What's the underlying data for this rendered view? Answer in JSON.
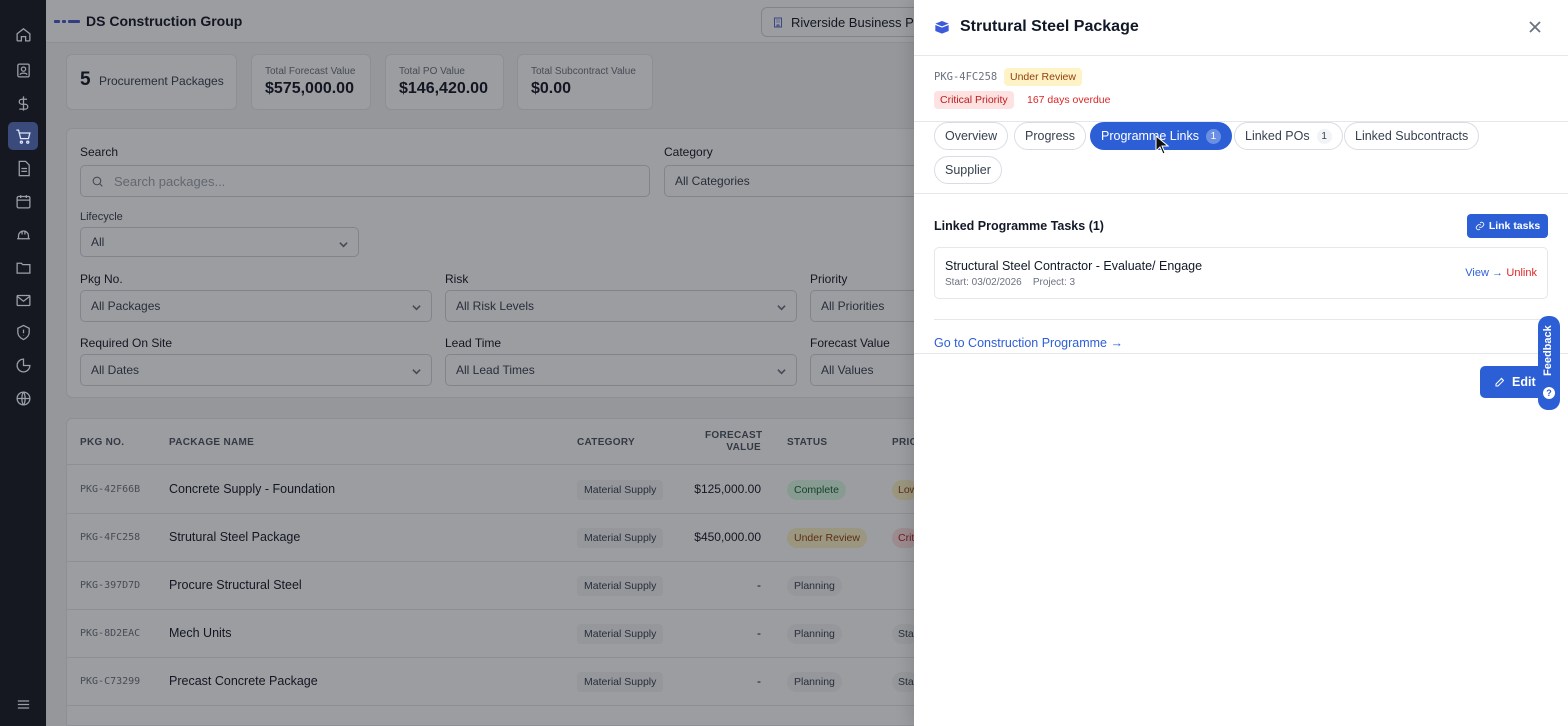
{
  "app": {
    "company": "DS Construction Group",
    "project": "Riverside Business Park"
  },
  "rail": [
    "home-icon",
    "contacts-icon",
    "dollar-icon",
    "cart-icon",
    "document-icon",
    "calendar-icon",
    "hardhat-icon",
    "folder-icon",
    "mail-icon",
    "shield-icon",
    "pie-chart-icon",
    "globe-icon",
    "menu-icon"
  ],
  "stats": {
    "packages_count": "5",
    "packages_label": "Procurement Packages",
    "forecast_label": "Total Forecast Value",
    "forecast_value": "$575,000.00",
    "po_label": "Total PO Value",
    "po_value": "$146,420.00",
    "subcontract_label": "Total Subcontract Value",
    "subcontract_value": "$0.00"
  },
  "filters": {
    "search_label": "Search",
    "search_placeholder": "Search packages...",
    "category_label": "Category",
    "category_value": "All Categories",
    "lifecycle_label": "Lifecycle",
    "lifecycle_value": "All",
    "pkgno_label": "Pkg No.",
    "pkgno_value": "All Packages",
    "risk_label": "Risk",
    "risk_value": "All Risk Levels",
    "priority_label": "Priority",
    "priority_value": "All Priorities",
    "required_label": "Required On Site",
    "required_value": "All Dates",
    "lead_label": "Lead Time",
    "lead_value": "All Lead Times",
    "forecast_label": "Forecast Value",
    "forecast_value": "All Values"
  },
  "table": {
    "headers": {
      "pkg": "PKG NO.",
      "name": "PACKAGE NAME",
      "category": "CATEGORY",
      "forecast_1": "FORECAST",
      "forecast_2": "VALUE",
      "status": "STATUS",
      "priority": "PRIO"
    },
    "rows": [
      {
        "id": "PKG-42F66B",
        "name": "Concrete Supply - Foundation",
        "category": "Material Supply",
        "forecast": "$125,000.00",
        "status": "Complete",
        "priority": "Low"
      },
      {
        "id": "PKG-4FC258",
        "name": "Strutural Steel Package",
        "category": "Material Supply",
        "forecast": "$450,000.00",
        "status": "Under Review",
        "priority": "Critical"
      },
      {
        "id": "PKG-397D7D",
        "name": "Procure Structural Steel",
        "category": "Material Supply",
        "forecast": "-",
        "status": "Planning",
        "priority": ""
      },
      {
        "id": "PKG-8D2EAC",
        "name": "Mech Units",
        "category": "Material Supply",
        "forecast": "-",
        "status": "Planning",
        "priority": "Standard"
      },
      {
        "id": "PKG-C73299",
        "name": "Precast Concrete Package",
        "category": "Material Supply",
        "forecast": "-",
        "status": "Planning",
        "priority": "Standard"
      }
    ]
  },
  "drawer": {
    "title": "Strutural Steel Package",
    "pkg_id": "PKG-4FC258",
    "status_badge": "Under Review",
    "priority_badge": "Critical Priority",
    "overdue": "167 days overdue",
    "tabs": [
      {
        "label": "Overview",
        "count": ""
      },
      {
        "label": "Progress",
        "count": ""
      },
      {
        "label": "Programme Links",
        "count": "1"
      },
      {
        "label": "Linked POs",
        "count": "1"
      },
      {
        "label": "Linked Subcontracts",
        "count": ""
      },
      {
        "label": "Supplier",
        "count": ""
      }
    ],
    "section_title": "Linked Programme Tasks (1)",
    "link_tasks": "Link tasks",
    "task": {
      "name": "Structural Steel Contractor - Evaluate/ Engage",
      "meta": "Start: 03/02/2026    Project: 3",
      "view": "View →",
      "unlink": "Unlink"
    },
    "go_programme": "Go to Construction Programme →",
    "edit": "Edit",
    "feedback": "Feedback",
    "feedback_q": "?"
  },
  "colors": {
    "accent": "#2c5fd6",
    "danger": "#dc2626",
    "warning_bg": "#fef3c7",
    "success_bg": "#dcfce7"
  }
}
